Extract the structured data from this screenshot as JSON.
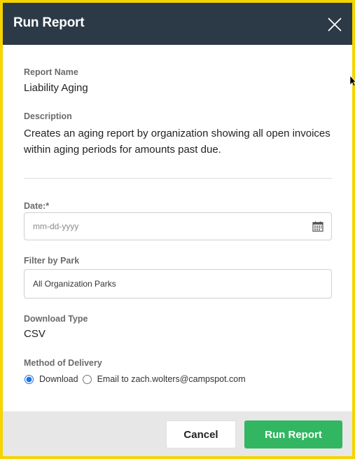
{
  "modal": {
    "title": "Run Report",
    "close_icon": "close-icon"
  },
  "report": {
    "name_label": "Report Name",
    "name_value": "Liability Aging",
    "description_label": "Description",
    "description_value": "Creates an aging report by organization showing all open invoices within aging periods for amounts past due."
  },
  "form": {
    "date_label": "Date:*",
    "date_placeholder": "mm-dd-yyyy",
    "date_icon": "calendar-icon",
    "filter_label": "Filter by Park",
    "filter_value": "All Organization Parks",
    "download_type_label": "Download Type",
    "download_type_value": "CSV",
    "delivery_label": "Method of Delivery",
    "delivery_options": [
      {
        "label": "Download",
        "selected": true
      },
      {
        "label": "Email to zach.wolters@campspot.com",
        "selected": false
      }
    ]
  },
  "footer": {
    "cancel_label": "Cancel",
    "run_label": "Run Report"
  },
  "colors": {
    "header_bg": "#2c3a47",
    "run_button": "#33b661",
    "frame": "#f5d400"
  }
}
